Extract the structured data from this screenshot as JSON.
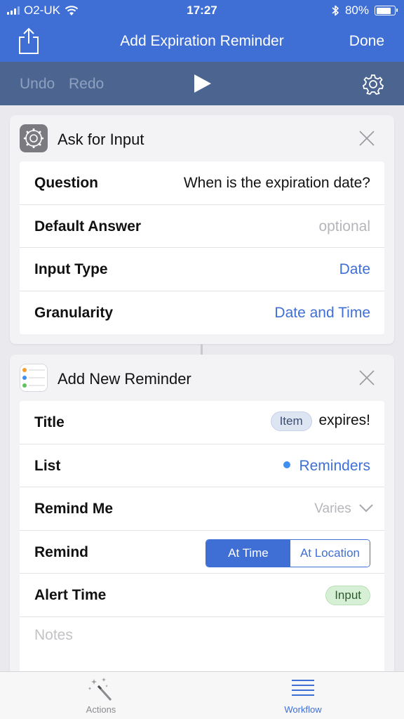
{
  "status_bar": {
    "carrier": "O2-UK",
    "time": "17:27",
    "battery": "80%",
    "battery_level": 0.8,
    "icons": [
      "signal-icon",
      "wifi-icon",
      "bluetooth-icon",
      "battery-icon"
    ]
  },
  "nav": {
    "title": "Add Expiration Reminder",
    "done": "Done",
    "share_icon": "share-icon"
  },
  "toolbar": {
    "undo": "Undo",
    "redo": "Redo",
    "play_icon": "play-icon",
    "settings_icon": "gear-icon"
  },
  "ask_for_input": {
    "title": "Ask for Input",
    "rows": {
      "question": {
        "label": "Question",
        "value": "When is the expiration date?"
      },
      "default_answer": {
        "label": "Default Answer",
        "placeholder": "optional"
      },
      "input_type": {
        "label": "Input Type",
        "value": "Date"
      },
      "granularity": {
        "label": "Granularity",
        "value": "Date and Time"
      }
    }
  },
  "add_reminder": {
    "title": "Add New Reminder",
    "rows": {
      "title": {
        "label": "Title",
        "token": "Item",
        "suffix": "expires!"
      },
      "list": {
        "label": "List",
        "value": "Reminders"
      },
      "remind_me": {
        "label": "Remind Me",
        "value": "Varies"
      },
      "remind": {
        "label": "Remind",
        "options": [
          "At Time",
          "At Location"
        ],
        "selected": "At Time"
      },
      "alert_time": {
        "label": "Alert Time",
        "token": "Input"
      }
    },
    "notes_placeholder": "Notes"
  },
  "tabs": {
    "actions": "Actions",
    "workflow": "Workflow",
    "active": "Workflow"
  },
  "colors": {
    "accent": "#3f6fd5",
    "toolbar": "#4c6590",
    "token_blue": "#dde5f3",
    "token_green": "#d6f0d6"
  }
}
